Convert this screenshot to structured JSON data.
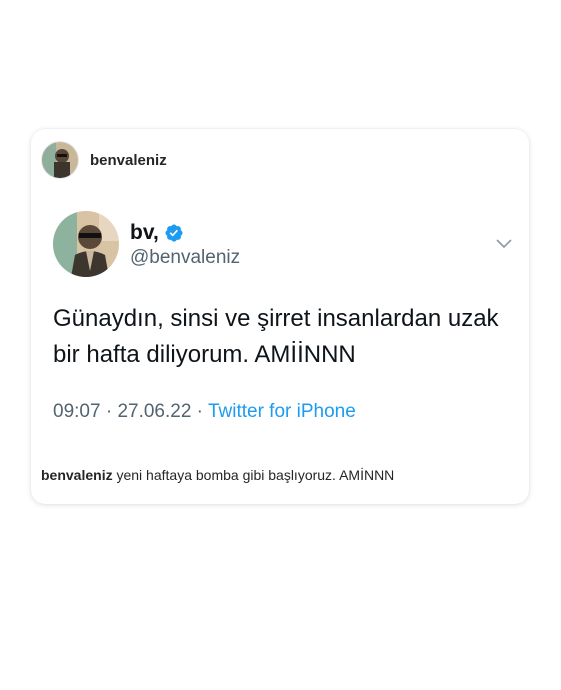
{
  "post": {
    "username": "benvaleniz",
    "caption_user": "benvaleniz",
    "caption_text": "yeni haftaya bomba gibi başlıyoruz. AMİNNN"
  },
  "tweet": {
    "display_name": "bv,",
    "handle": "@benvaleniz",
    "verified_icon": "verified-badge-icon",
    "menu_icon": "chevron-down-icon",
    "text": "Günaydın, sinsi ve şirret insanlardan uzak bir hafta diliyorum. AMİİNNN",
    "time": "09:07",
    "separator": " · ",
    "date": "27.06.22",
    "source": "Twitter for iPhone"
  },
  "colors": {
    "accent": "#1d9bf0",
    "secondary_text": "#536471",
    "primary_text": "#0f1419"
  }
}
